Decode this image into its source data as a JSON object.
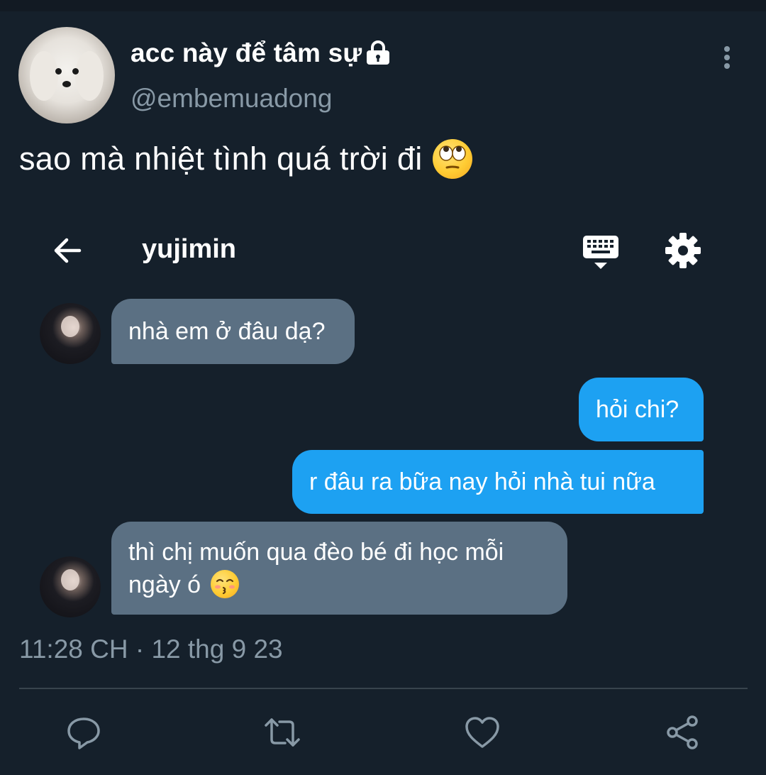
{
  "tweet": {
    "display_name": "acc này để tâm sự",
    "handle": "@embemuadong",
    "text": "sao mà nhiệt tình quá trời đi",
    "timestamp": "11:28 CH · 12 thg 9 23"
  },
  "dm": {
    "contact_name": "yujimin",
    "messages": [
      {
        "side": "in",
        "text": "nhà em ở đâu dạ?"
      },
      {
        "side": "out",
        "text": "hỏi chi?"
      },
      {
        "side": "out",
        "text": "r đâu ra bữa nay hỏi nhà tui nữa"
      },
      {
        "side": "in",
        "text": "thì chị muốn qua đèo bé đi học mỗi ngày ó"
      }
    ]
  },
  "icons": {
    "header": [
      "lock-icon",
      "more-icon"
    ],
    "dm": [
      "back-arrow-icon",
      "keyboard-icon",
      "gear-icon"
    ],
    "actions": [
      "reply-icon",
      "retweet-icon",
      "like-icon",
      "share-icon"
    ],
    "emoji": [
      "eye-roll-emoji",
      "kissing-emoji"
    ]
  },
  "colors": {
    "background": "#15202b",
    "secondary_text": "#8899a6",
    "incoming_bubble": "#5b7083",
    "outgoing_bubble": "#1da1f2",
    "divider": "#38444d"
  }
}
